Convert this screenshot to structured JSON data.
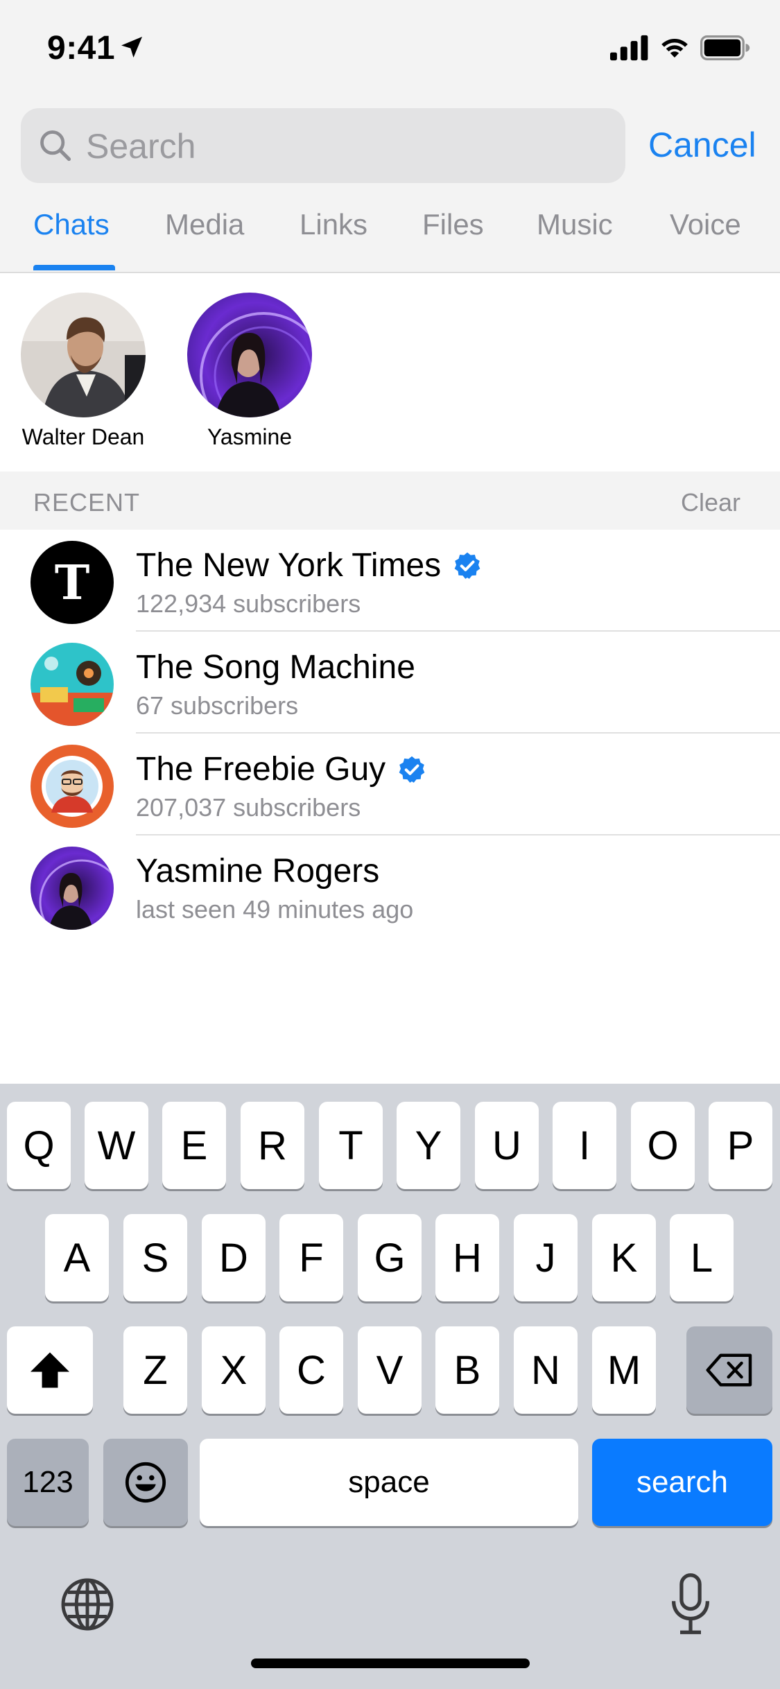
{
  "status": {
    "time": "9:41"
  },
  "search": {
    "placeholder": "Search",
    "cancel": "Cancel"
  },
  "tabs": [
    {
      "label": "Chats",
      "active": true
    },
    {
      "label": "Media"
    },
    {
      "label": "Links"
    },
    {
      "label": "Files"
    },
    {
      "label": "Music"
    },
    {
      "label": "Voice"
    }
  ],
  "recent_people": [
    {
      "name": "Walter Dean"
    },
    {
      "name": "Yasmine"
    }
  ],
  "recent_section": {
    "title": "RECENT",
    "clear": "Clear"
  },
  "chats": [
    {
      "title": "The New York Times",
      "subtitle": "122,934 subscribers",
      "verified": true
    },
    {
      "title": "The Song Machine",
      "subtitle": "67 subscribers",
      "verified": false
    },
    {
      "title": "The Freebie Guy",
      "subtitle": "207,037 subscribers",
      "verified": true
    },
    {
      "title": "Yasmine Rogers",
      "subtitle": "last seen 49 minutes ago",
      "verified": false
    }
  ],
  "keyboard": {
    "row1": [
      "Q",
      "W",
      "E",
      "R",
      "T",
      "Y",
      "U",
      "I",
      "O",
      "P"
    ],
    "row2": [
      "A",
      "S",
      "D",
      "F",
      "G",
      "H",
      "J",
      "K",
      "L"
    ],
    "row3": [
      "Z",
      "X",
      "C",
      "V",
      "B",
      "N",
      "M"
    ],
    "numbers": "123",
    "space": "space",
    "action": "search"
  },
  "colors": {
    "accent": "#1a82f0",
    "keyboard_bg": "#d1d4da",
    "search_key": "#0a7bff"
  }
}
